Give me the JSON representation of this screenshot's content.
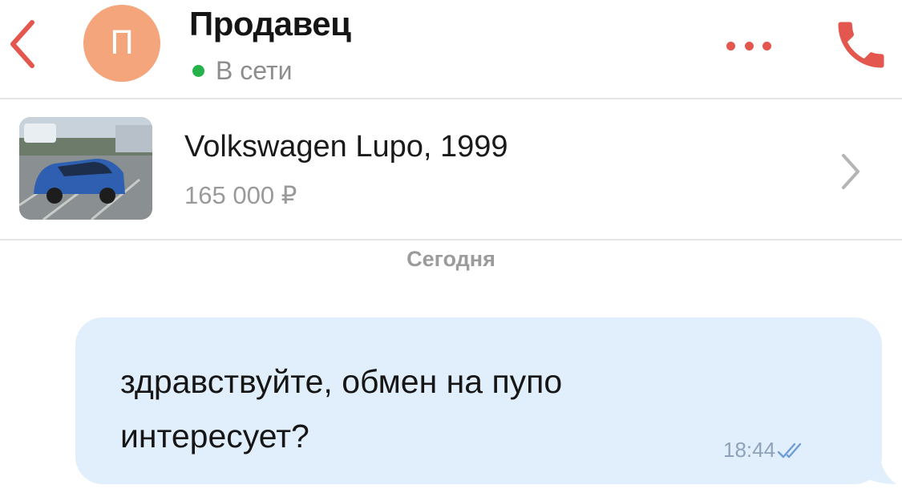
{
  "header": {
    "avatar_letter": "П",
    "seller_name": "Продавец",
    "status": "В сети",
    "accent_color": "#e4574e",
    "online_color": "#25b24a",
    "icons": [
      "back-chevron-icon",
      "more-dots-icon",
      "phone-icon"
    ]
  },
  "listing": {
    "title": "Volkswagen Lupo, 1999",
    "price": "165 000 ₽"
  },
  "date_separator": "Сегодня",
  "message": {
    "line1": "здравствуйте, обмен на пупо",
    "line2": "интересует?",
    "time": "18:44",
    "status_icon": "double-check-icon",
    "bubble_color": "#e1eefb"
  }
}
